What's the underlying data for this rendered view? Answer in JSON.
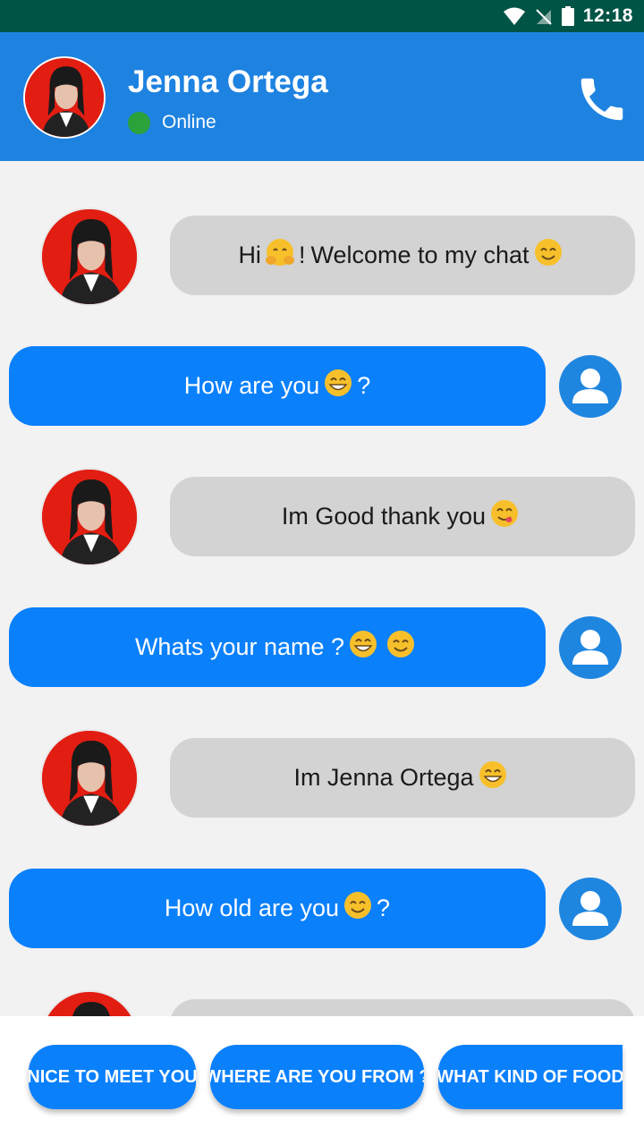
{
  "status_bar": {
    "time": "12:18"
  },
  "header": {
    "name": "Jenna Ortega",
    "status": "Online"
  },
  "messages": [
    {
      "from": "bot",
      "parts": [
        "Hi",
        "!",
        "Welcome to my chat"
      ],
      "emojis": [
        "hugging-face",
        "smiling-face"
      ]
    },
    {
      "from": "user",
      "parts": [
        "How are you",
        "?"
      ],
      "emojis": [
        "grinning-face"
      ]
    },
    {
      "from": "bot",
      "parts": [
        "Im Good thank you"
      ],
      "emojis": [
        "yum-face"
      ]
    },
    {
      "from": "user",
      "parts": [
        "Whats your name ?"
      ],
      "emojis": [
        "grinning-face",
        "smiling-face"
      ]
    },
    {
      "from": "bot",
      "parts": [
        "Im Jenna Ortega"
      ],
      "emojis": [
        "grinning-face"
      ]
    },
    {
      "from": "user",
      "parts": [
        "How old are you",
        "?"
      ],
      "emojis": [
        "smiling-face"
      ]
    }
  ],
  "suggestions": [
    "NICE TO MEET YOU",
    "WHERE ARE YOU FROM ?",
    "WHAT KIND OF FOOD"
  ],
  "colors": {
    "status_bar": "#005446",
    "header": "#1e82e0",
    "user_bubble": "#0a80fb",
    "bot_bubble": "#d3d3d3",
    "online": "#2ca23a"
  }
}
